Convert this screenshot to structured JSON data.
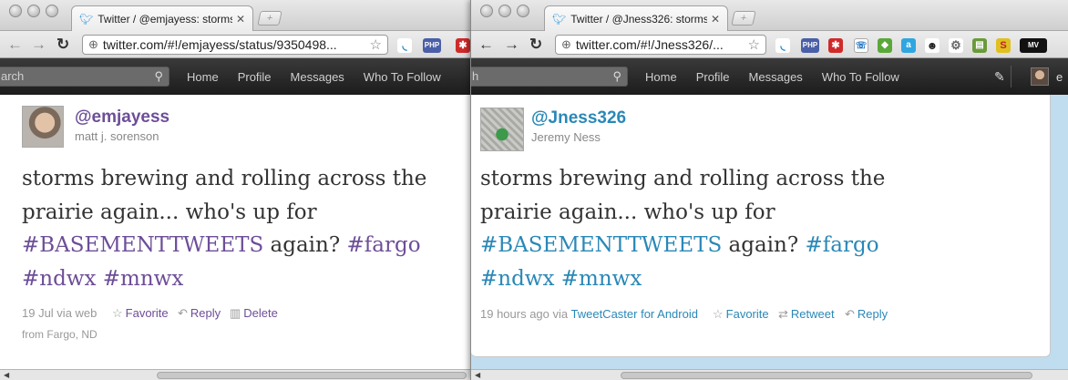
{
  "left": {
    "tab_title": "Twitter / @emjayess: storms",
    "url": "twitter.com/#!/emjayess/status/9350498...",
    "search_placeholder": "arch",
    "nav": [
      "Home",
      "Profile",
      "Messages",
      "Who To Follow"
    ],
    "screen_name": "@emjayess",
    "full_name": "matt j. sorenson",
    "tweet": {
      "line1": "storms brewing and rolling across the",
      "line2": "prairie again... who's up for",
      "hashtag1": "#BASEMENTTWEETS",
      "again": " again? ",
      "hashtag2": "#fargo",
      "hashtag3": "#ndwx",
      "hashtag4": "#mnwx"
    },
    "meta": "19 Jul via web",
    "actions": {
      "favorite": "Favorite",
      "reply": "Reply",
      "delete": "Delete"
    },
    "place": "from Fargo, ND",
    "ext_labels": {
      "php": "PHP"
    },
    "accent": "#6d4e98"
  },
  "right": {
    "tab_title": "Twitter / @Jness326: storms",
    "url": "twitter.com/#!/Jness326/...",
    "search_placeholder": "h",
    "nav": [
      "Home",
      "Profile",
      "Messages",
      "Who To Follow"
    ],
    "screen_name": "@Jness326",
    "full_name": "Jeremy Ness",
    "tweet": {
      "line1": "storms brewing and rolling across the",
      "line2": "prairie again... who's up for",
      "hashtag1": "#BASEMENTTWEETS",
      "again": " again? ",
      "hashtag2": "#fargo",
      "hashtag3": "#ndwx",
      "hashtag4": "#mnwx"
    },
    "meta_prefix": "19 hours ago via ",
    "meta_source": "TweetCaster for Android",
    "actions": {
      "favorite": "Favorite",
      "retweet": "Retweet",
      "reply": "Reply"
    },
    "ext_labels": {
      "php": "PHP",
      "mv": "MV"
    },
    "header_user_fragment": "e",
    "accent": "#2a88b7"
  }
}
